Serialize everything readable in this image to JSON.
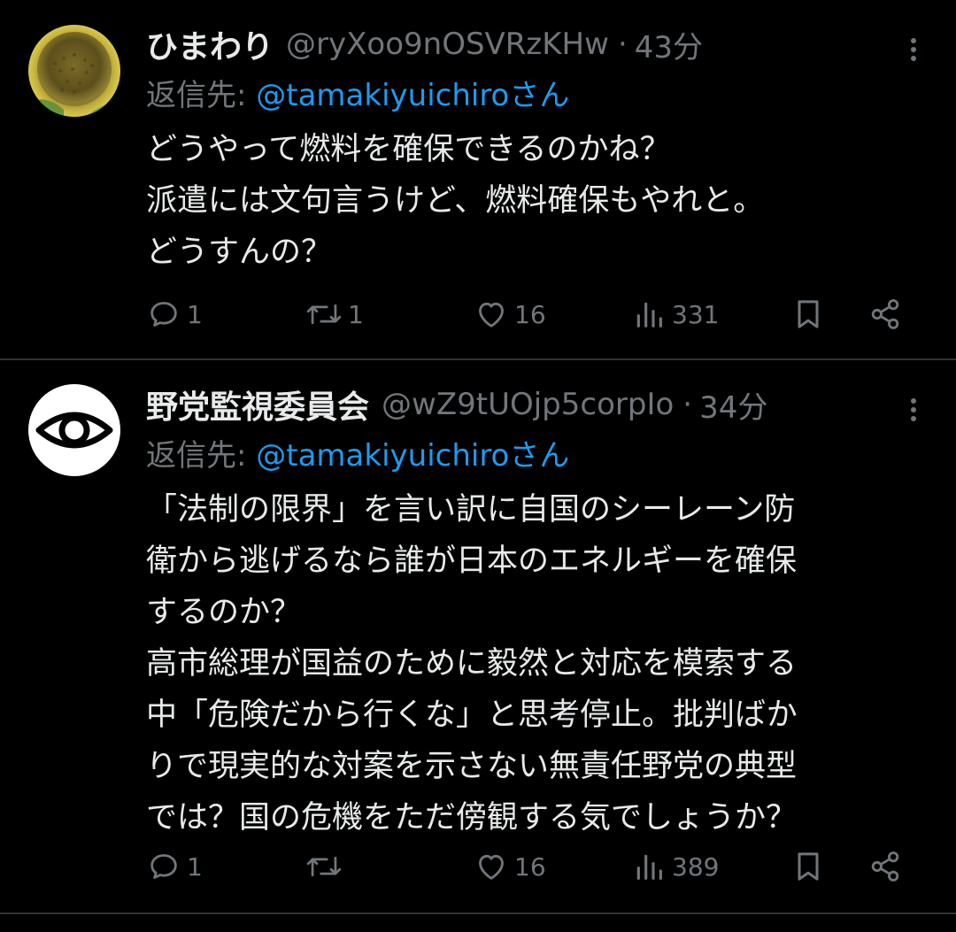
{
  "tweets": [
    {
      "name": "ひまわり",
      "handle": "@ryXoo9nOSVRzKHw",
      "separator": "·",
      "time": "43分",
      "reply_prefix": "返信先: ",
      "reply_mention": "@tamakiyuichiroさん",
      "body_lines": [
        "どうやって燃料を確保できるのかね？",
        "派遣には文句言うけど、燃料確保もやれと。",
        "どうすんの？"
      ],
      "replies": "1",
      "reposts": "1",
      "likes": "16",
      "views": "331",
      "avatar_icon": "sunflower-avatar"
    },
    {
      "name": "野党監視委員会",
      "handle": "@wZ9tUOjp5corpIo",
      "separator": "·",
      "time": "34分",
      "reply_prefix": "返信先: ",
      "reply_mention": "@tamakiyuichiroさん",
      "body_lines": [
        "「法制の限界」を言い訳に自国のシーレーン防",
        "衛から逃げるなら誰が日本のエネルギーを確保",
        "するのか？",
        "高市総理が国益のために毅然と対応を模索する",
        "中「危険だから行くな」と思考停止。批判ばか",
        "りで現実的な対案を示さない無責任野党の典型",
        "では？国の危機をただ傍観する気でしょうか？"
      ],
      "replies": "1",
      "reposts": "",
      "likes": "16",
      "views": "389",
      "avatar_icon": "eye-avatar"
    }
  ],
  "colors": {
    "background": "#000000",
    "text": "#e7e9ea",
    "muted": "#71767b",
    "link": "#1d9bf0",
    "divider": "#2f3336"
  }
}
